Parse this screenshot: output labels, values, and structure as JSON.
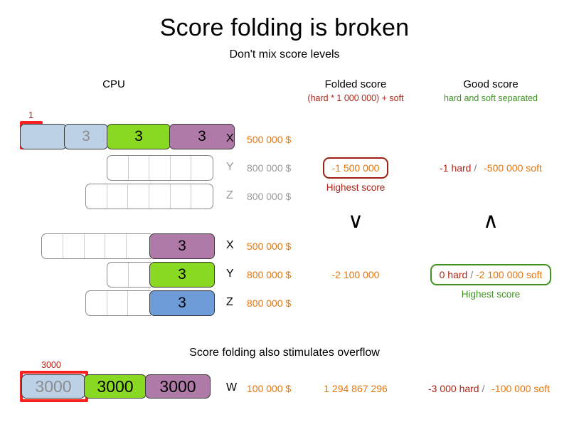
{
  "header": {
    "title": "Score folding is broken",
    "subtitle": "Don't mix score levels",
    "section_title": "Score folding also stimulates overflow"
  },
  "columns": {
    "cpu": "CPU",
    "folded": {
      "title": "Folded score",
      "formula": "(hard * 1 000 000) + soft"
    },
    "good": {
      "title": "Good score",
      "formula": "hard and soft separated"
    }
  },
  "colors": {
    "light_blue": "#bcd0e6",
    "green": "#89d822",
    "purple": "#b07aa8",
    "steel_blue": "#6d9cd8",
    "highlight_red": "#fa2020",
    "dark_red": "#b02418",
    "orange": "#e8760c",
    "good_green": "#3f9220",
    "grey": "#9a9a9a"
  },
  "group1": {
    "highlight_label": "1",
    "rows": [
      {
        "label": "X",
        "value": "500 000 $",
        "active": true,
        "segments": [
          {
            "text": "",
            "color": "blue",
            "highlighted": true
          },
          {
            "text": "3",
            "color": "blue",
            "highlighted": false
          },
          {
            "text": "3",
            "color": "green",
            "highlighted": false
          },
          {
            "text": "3",
            "color": "purple",
            "highlighted": false
          }
        ]
      },
      {
        "label": "Y",
        "value": "800 000 $",
        "active": false,
        "segments": []
      },
      {
        "label": "Z",
        "value": "800 000 $",
        "active": false,
        "segments": []
      }
    ],
    "folded_score": "-1 500 000",
    "folded_highest": "Highest score",
    "good_hard": "-1 hard",
    "good_separator": "/",
    "good_soft": "-500 000 soft"
  },
  "comparison": {
    "folded": "∨",
    "good": "∧"
  },
  "group2": {
    "rows": [
      {
        "label": "X",
        "value": "500 000 $",
        "active": true,
        "fill": "purple",
        "fill_text": "3"
      },
      {
        "label": "Y",
        "value": "800 000 $",
        "active": true,
        "fill": "green",
        "fill_text": "3"
      },
      {
        "label": "Z",
        "value": "800 000 $",
        "active": true,
        "fill": "steel",
        "fill_text": "3"
      }
    ],
    "folded_score": "-2 100 000",
    "good_hard": "0 hard",
    "good_separator": "/",
    "good_soft": "-2 100 000 soft",
    "good_highest": "Highest score"
  },
  "overflow_row": {
    "highlight_label": "3000",
    "label": "W",
    "value": "100 000 $",
    "segments": [
      {
        "text": "3000",
        "color": "blue",
        "highlighted": true
      },
      {
        "text": "3000",
        "color": "green",
        "highlighted": false
      },
      {
        "text": "3000",
        "color": "purple",
        "highlighted": false
      }
    ],
    "folded_score": "1 294 867 296",
    "good_hard": "-3 000 hard",
    "good_separator": "/",
    "good_soft": "-100 000 soft"
  }
}
